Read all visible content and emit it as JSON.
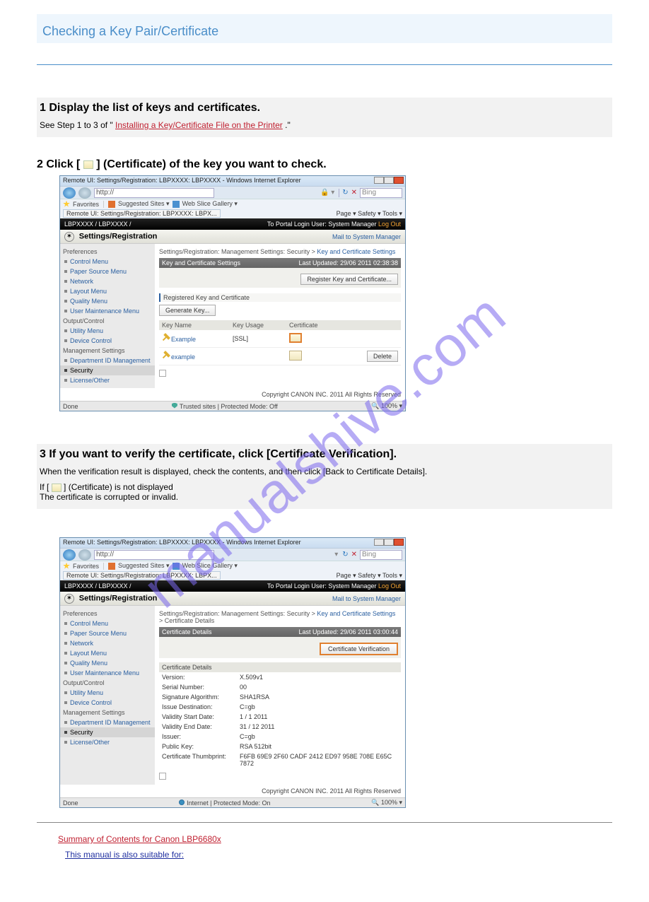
{
  "doc_title": "Checking a Key Pair/Certificate",
  "steps": {
    "s1": {
      "heading": "1   Display the list of keys and certificates.",
      "note_prefix": "See Step 1 to 3 of \"",
      "note_link": "Installing a Key/Certificate File on the Printer",
      "note_suffix": ".\""
    },
    "s2": {
      "heading": "2   Click [",
      "icon": true,
      "heading_end": "] (Certificate) of the key you want to check."
    },
    "s3": {
      "heading": "3   If you want to verify the certificate, click [Certificate Verification].",
      "body1": "When the verification result is displayed, check the contents, and then click [Back to Certificate Details].",
      "body_icon_prefix": "If [",
      "body_icon_suffix": "] (Certificate) is not displayed",
      "body2": "The certificate is corrupted or invalid."
    }
  },
  "browser_common": {
    "title": "Remote UI: Settings/Registration: LBPXXXX: LBPXXXX - Windows Internet Explorer",
    "url": "http://",
    "search_placeholder": "Bing",
    "fav_sites": "Suggested Sites ▾",
    "fav_gallery": "Web Slice Gallery ▾",
    "tab": "Remote UI: Settings/Registration: LBPXXXX: LBPX...",
    "menu": "Page ▾   Safety ▾   Tools ▾",
    "black_left": "LBPXXXX / LBPXXXX /",
    "black_right": "To Portal   Login User: System Manager ",
    "logout": "Log Out",
    "settings": "Settings/Registration",
    "mail": "Mail to System Manager",
    "copyright": "Copyright CANON INC. 2011 All Rights Reserved",
    "status_done": "Done",
    "zoom": "100%"
  },
  "sidebar": {
    "preferences": "Preferences",
    "control": "Control Menu",
    "paper": "Paper Source Menu",
    "network": "Network",
    "layout": "Layout Menu",
    "quality": "Quality Menu",
    "usermaint": "User Maintenance Menu",
    "output": "Output/Control",
    "utility": "Utility Menu",
    "device": "Device Control",
    "mgmt": "Management Settings",
    "deptid": "Department ID Management",
    "security": "Security",
    "license": "License/Other"
  },
  "screen1": {
    "crumbs_prefix": "Settings/Registration: Management Settings: Security > ",
    "crumbs_link": "Key and Certificate Settings",
    "panel_title": "Key and Certificate Settings",
    "panel_time": "Last Updated: 29/06 2011 02:38:38",
    "btn_register": "Register Key and Certificate...",
    "section": "Registered Key and Certificate",
    "btn_generate": "Generate Key...",
    "col1": "Key Name",
    "col2": "Key Usage",
    "col3": "Certificate",
    "row1": {
      "name": "Example",
      "usage": "[SSL]"
    },
    "row2": {
      "name": "example",
      "usage": ""
    },
    "btn_delete": "Delete",
    "status_mid": "Trusted sites | Protected Mode: Off"
  },
  "screen2": {
    "crumbs_prefix": "Settings/Registration: Management Settings: Security > ",
    "crumbs_link1": "Key and Certificate Settings",
    "crumbs_sep": " > ",
    "crumbs_end": "Certificate Details",
    "panel_title": "Certificate Details",
    "panel_time": "Last Updated: 29/06 2011 03:00:44",
    "btn_verify": "Certificate Verification",
    "section": "Certificate Details",
    "rows": [
      {
        "lab": "Version:",
        "val": "X.509v1"
      },
      {
        "lab": "Serial Number:",
        "val": "00"
      },
      {
        "lab": "Signature Algorithm:",
        "val": "SHA1RSA"
      },
      {
        "lab": "Issue Destination:",
        "val": "C=gb"
      },
      {
        "lab": "Validity Start Date:",
        "val": "1 / 1 2011"
      },
      {
        "lab": "Validity End Date:",
        "val": "31 / 12 2011"
      },
      {
        "lab": "Issuer:",
        "val": "C=gb"
      },
      {
        "lab": "Public Key:",
        "val": "RSA 512bit"
      },
      {
        "lab": "Certificate Thumbprint:",
        "val": "F6FB 69E9 2F60 CADF 2412 ED97 958E 708E E65C 7872"
      }
    ],
    "status_mid": "Internet | Protected Mode: On"
  },
  "footer": {
    "link1": "Summary of Contents for Canon LBP6680x",
    "link2": "This manual is also suitable for:"
  }
}
